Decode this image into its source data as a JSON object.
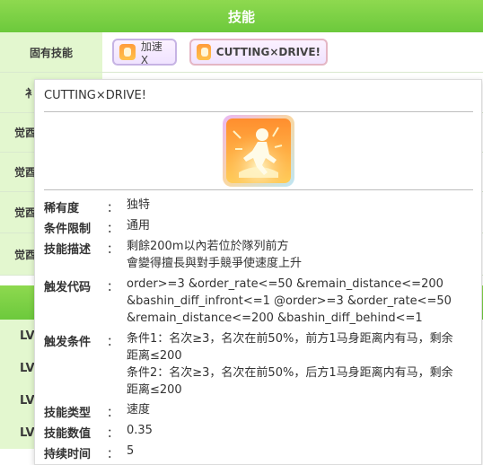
{
  "header": {
    "title": "技能"
  },
  "row_labels": {
    "unique": "固有技能",
    "evolve_partial": "衤",
    "awaken1": "觉酉",
    "awaken2": "觉酉",
    "awaken3": "觉酉",
    "awaken4": "觉酉"
  },
  "skills": [
    {
      "label": "加速X"
    },
    {
      "label": "CUTTING×DRIVE!"
    }
  ],
  "lv_rows": [
    "LV",
    "LV",
    "LV",
    "LV"
  ],
  "tooltip": {
    "title": "CUTTING×DRIVE!",
    "icon": "running-figure-icon",
    "fields": [
      {
        "label": "稀有度",
        "colon": "：",
        "value": "独特"
      },
      {
        "label": "条件限制",
        "colon": "：",
        "value": "通用"
      },
      {
        "label": "技能描述",
        "colon": "：",
        "value": "剩餘200m以內若位於隊列前方\n會變得擅長與對手競爭使速度上升"
      },
      {
        "label": "触发代码",
        "colon": "：",
        "value": "order>=3 &order_rate<=50 &remain_distance<=200\n&bashin_diff_infront<=1 @order>=3 &order_rate<=50\n&remain_distance<=200 &bashin_diff_behind<=1"
      },
      {
        "label": "触发条件",
        "colon": "：",
        "value": "条件1：名次≥3，名次在前50%，前方1马身距离内有马，剩余\n距离≤200\n条件2：名次≥3，名次在前50%，后方1马身距离内有马，剩余\n距离≤200"
      },
      {
        "label": "技能类型",
        "colon": "：",
        "value": "速度"
      },
      {
        "label": "技能数值",
        "colon": "：",
        "value": "0.35"
      },
      {
        "label": "持续时间",
        "colon": "：",
        "value": "5"
      }
    ]
  }
}
